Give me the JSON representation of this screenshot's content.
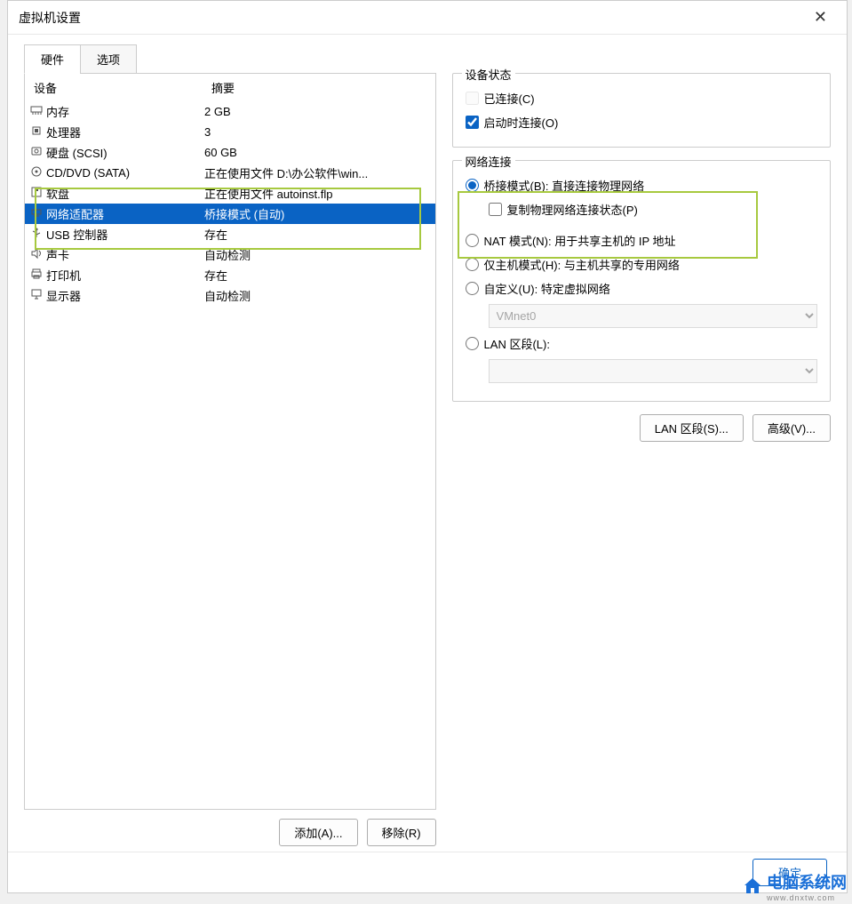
{
  "title": "虚拟机设置",
  "tabs": {
    "hardware": "硬件",
    "options": "选项"
  },
  "device_table": {
    "headers": {
      "device": "设备",
      "summary": "摘要"
    },
    "rows": [
      {
        "name": "内存",
        "summary": "2 GB",
        "icon": "memory"
      },
      {
        "name": "处理器",
        "summary": "3",
        "icon": "cpu"
      },
      {
        "name": "硬盘 (SCSI)",
        "summary": "60 GB",
        "icon": "disk"
      },
      {
        "name": "CD/DVD (SATA)",
        "summary": "正在使用文件 D:\\办公软件\\win...",
        "icon": "cd"
      },
      {
        "name": "软盘",
        "summary": "正在使用文件 autoinst.flp",
        "icon": "floppy"
      },
      {
        "name": "网络适配器",
        "summary": "桥接模式 (自动)",
        "icon": "network"
      },
      {
        "name": "USB 控制器",
        "summary": "存在",
        "icon": "usb"
      },
      {
        "name": "声卡",
        "summary": "自动检测",
        "icon": "sound"
      },
      {
        "name": "打印机",
        "summary": "存在",
        "icon": "printer"
      },
      {
        "name": "显示器",
        "summary": "自动检测",
        "icon": "display"
      }
    ]
  },
  "buttons": {
    "add": "添加(A)...",
    "remove": "移除(R)",
    "lan_segment_btn": "LAN 区段(S)...",
    "advanced": "高级(V)...",
    "ok": "确定"
  },
  "device_state": {
    "title": "设备状态",
    "connected": "已连接(C)",
    "connect_at_power_on": "启动时连接(O)"
  },
  "network_connection": {
    "title": "网络连接",
    "bridged": "桥接模式(B): 直接连接物理网络",
    "replicate": "复制物理网络连接状态(P)",
    "nat": "NAT 模式(N): 用于共享主机的 IP 地址",
    "hostonly": "仅主机模式(H): 与主机共享的专用网络",
    "custom": "自定义(U): 特定虚拟网络",
    "custom_select": "VMnet0",
    "lan_segment": "LAN 区段(L):",
    "lan_select": ""
  },
  "watermark": {
    "text": "电脑系统网",
    "sub": "www.dnxtw.com"
  }
}
